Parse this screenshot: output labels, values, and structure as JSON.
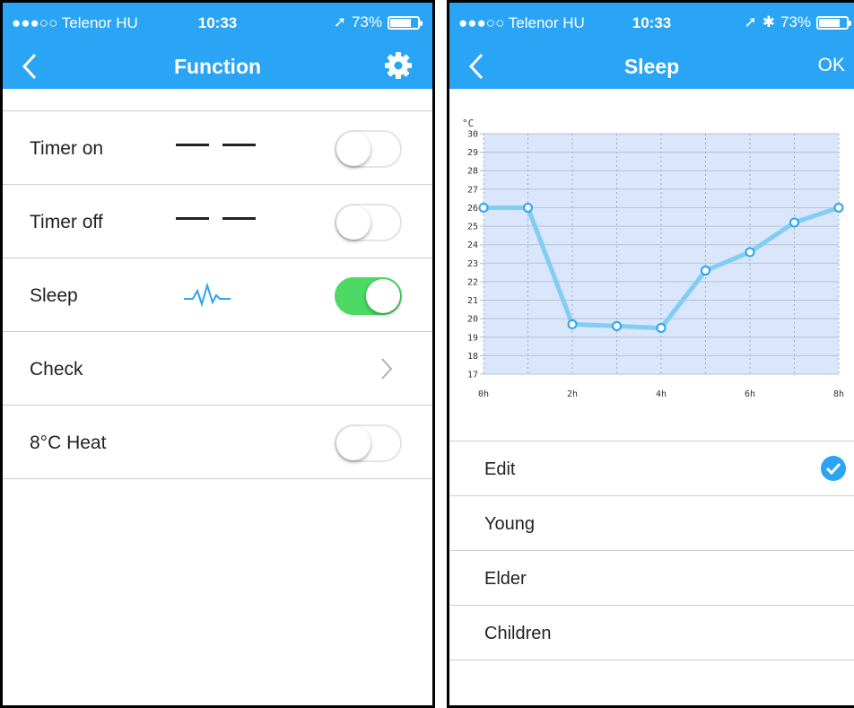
{
  "left_screen": {
    "status": {
      "carrier": "●●●○○ Telenor HU",
      "time": "10:33",
      "battery": "73%"
    },
    "title": "Function",
    "rows": [
      {
        "label": "Timer on",
        "control": "toggle",
        "on": false
      },
      {
        "label": "Timer off",
        "control": "toggle",
        "on": false
      },
      {
        "label": "Sleep",
        "control": "toggle",
        "on": true
      },
      {
        "label": "Check",
        "control": "chevron"
      },
      {
        "label": "8°C Heat",
        "control": "toggle",
        "on": false
      }
    ]
  },
  "right_screen": {
    "status": {
      "carrier": "●●●○○ Telenor HU",
      "time": "10:33",
      "battery": "73%"
    },
    "title": "Sleep",
    "ok_label": "OK",
    "modes": [
      {
        "label": "Edit",
        "selected": true
      },
      {
        "label": "Young",
        "selected": false
      },
      {
        "label": "Elder",
        "selected": false
      },
      {
        "label": "Children",
        "selected": false
      }
    ]
  },
  "colors": {
    "accent": "#2aa4f4",
    "toggle_on": "#4cd964",
    "chart_line": "#82cdf4",
    "chart_fill": "#d9e6fb"
  },
  "chart_data": {
    "type": "line",
    "ylabel": "°C",
    "ylim": [
      17,
      30
    ],
    "yticks": [
      17,
      18,
      19,
      20,
      21,
      22,
      23,
      24,
      25,
      26,
      27,
      28,
      29,
      30
    ],
    "xlim": [
      0,
      8
    ],
    "xtick_values": [
      0,
      2,
      4,
      6,
      8
    ],
    "xtick_labels": [
      "0h",
      "2h",
      "4h",
      "6h",
      "8h"
    ],
    "grid": true,
    "series": [
      {
        "x": [
          0,
          1,
          2,
          3,
          4,
          5,
          6,
          7,
          8
        ],
        "values": [
          26,
          26,
          19.7,
          19.6,
          19.5,
          22.6,
          23.6,
          25.2,
          26
        ]
      }
    ]
  }
}
